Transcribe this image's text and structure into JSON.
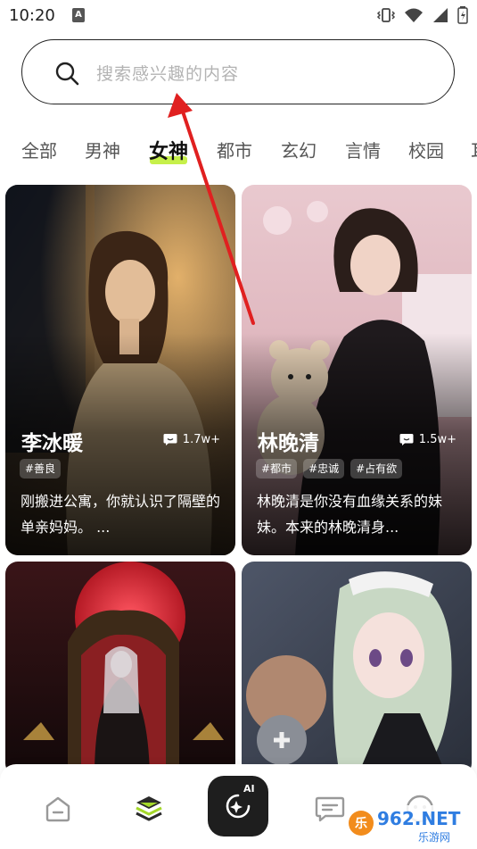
{
  "status_bar": {
    "time": "10:20",
    "app_badge": "A"
  },
  "search": {
    "placeholder": "搜索感兴趣的内容"
  },
  "tabs": [
    {
      "label": "全部"
    },
    {
      "label": "男神"
    },
    {
      "label": "女神",
      "active": true
    },
    {
      "label": "都市"
    },
    {
      "label": "玄幻"
    },
    {
      "label": "言情"
    },
    {
      "label": "校园"
    },
    {
      "label": "耳"
    }
  ],
  "cards": [
    {
      "name": "李冰暖",
      "count": "1.7w+",
      "tags": [
        "#善良"
      ],
      "description": "刚搬进公寓，你就认识了隔壁的单亲妈妈。 ..."
    },
    {
      "name": "林晚清",
      "count": "1.5w+",
      "tags": [
        "#都市",
        "#忠诚",
        "#占有欲"
      ],
      "description": "林晚清是你没有血缘关系的妹妹。本来的林晚清身..."
    },
    {
      "name": "",
      "count": "",
      "tags": [],
      "description": ""
    },
    {
      "name": "",
      "count": "",
      "tags": [],
      "description": ""
    }
  ],
  "bottom_nav": {
    "items": [
      "home-icon",
      "layers-icon",
      "ai-create-icon",
      "message-icon",
      "profile-icon"
    ],
    "ai_label": "AI"
  },
  "watermark": {
    "text": "962.NET",
    "subtext": "乐游网"
  },
  "colors": {
    "accent_underline": "#c6f04a",
    "annotation_arrow": "#e02020",
    "ai_button_bg": "#1e1e1e"
  }
}
